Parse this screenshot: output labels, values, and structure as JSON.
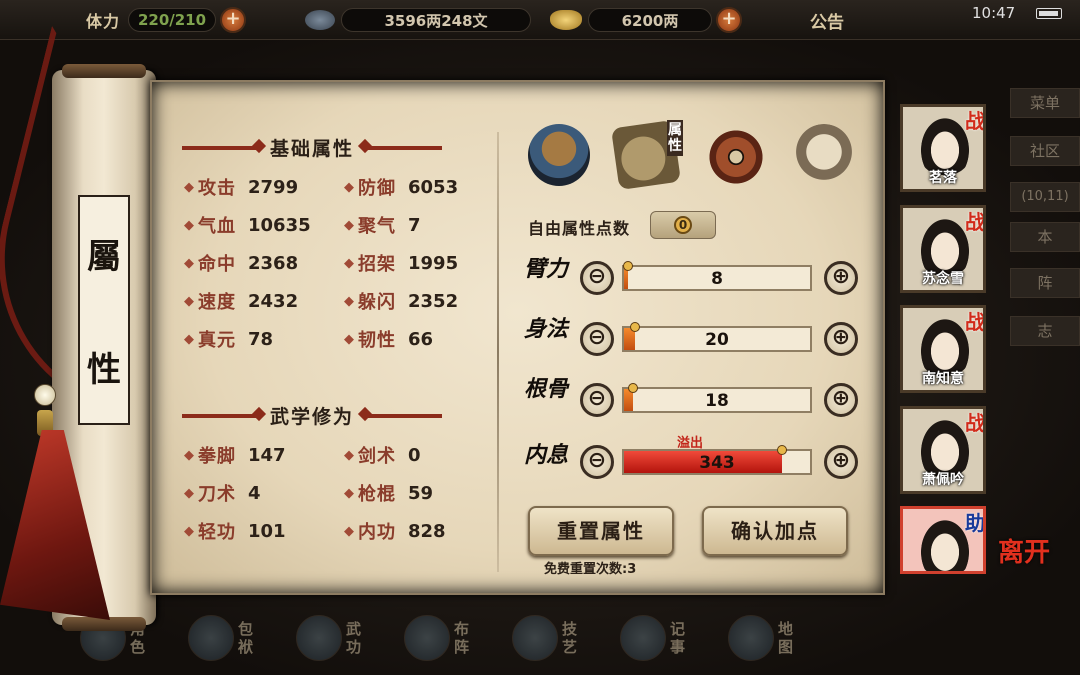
{
  "topbar": {
    "stamina_label": "体力",
    "stamina_value": "220/210",
    "silver_value": "3596两248文",
    "gold_value": "6200两",
    "notice_label": "公告",
    "clock": "10:47"
  },
  "right_menu": {
    "menu": "菜单",
    "community": "社区",
    "coords": "(10,11)",
    "item_a": "本",
    "item_b": "阵",
    "item_c": "志"
  },
  "scroll": {
    "title_top": "屬",
    "title_bottom": "性"
  },
  "basic": {
    "title": "基础属性",
    "stats": [
      {
        "name": "攻击",
        "value": "2799"
      },
      {
        "name": "防御",
        "value": "6053"
      },
      {
        "name": "气血",
        "value": "10635"
      },
      {
        "name": "聚气",
        "value": "7"
      },
      {
        "name": "命中",
        "value": "2368"
      },
      {
        "name": "招架",
        "value": "1995"
      },
      {
        "name": "速度",
        "value": "2432"
      },
      {
        "name": "躲闪",
        "value": "2352"
      },
      {
        "name": "真元",
        "value": "78"
      },
      {
        "name": "韧性",
        "value": "66"
      }
    ]
  },
  "martial": {
    "title": "武学修为",
    "stats": [
      {
        "name": "拳脚",
        "value": "147"
      },
      {
        "name": "剑术",
        "value": "0"
      },
      {
        "name": "刀术",
        "value": "4"
      },
      {
        "name": "枪棍",
        "value": "59"
      },
      {
        "name": "轻功",
        "value": "101"
      },
      {
        "name": "内功",
        "value": "828"
      }
    ]
  },
  "tabs": {
    "attr_tab_label": "属性"
  },
  "points": {
    "free_label": "自由属性点数",
    "free_value": "0",
    "attrs": [
      {
        "name": "臂力",
        "value": "8",
        "fill": 0.02,
        "overflow": false
      },
      {
        "name": "身法",
        "value": "20",
        "fill": 0.06,
        "overflow": false
      },
      {
        "name": "根骨",
        "value": "18",
        "fill": 0.05,
        "overflow": false
      },
      {
        "name": "内息",
        "value": "343",
        "fill": 0.85,
        "overflow": true
      }
    ],
    "overflow_label": "溢出",
    "minus_symbol": "⊖",
    "plus_symbol": "⊕"
  },
  "buttons": {
    "reset": "重置属性",
    "confirm": "确认加点",
    "free_reset": "免费重置次数:3"
  },
  "party": [
    {
      "name": "茗落",
      "tag": "战"
    },
    {
      "name": "苏念雪",
      "tag": "战"
    },
    {
      "name": "南知意",
      "tag": "战"
    },
    {
      "name": "萧佩吟",
      "tag": "战"
    },
    {
      "name": "",
      "tag": "助"
    }
  ],
  "leave_label": "离开",
  "bottom_nav": [
    "角色",
    "包袱",
    "武功",
    "布阵",
    "技艺",
    "记事",
    "地图"
  ]
}
